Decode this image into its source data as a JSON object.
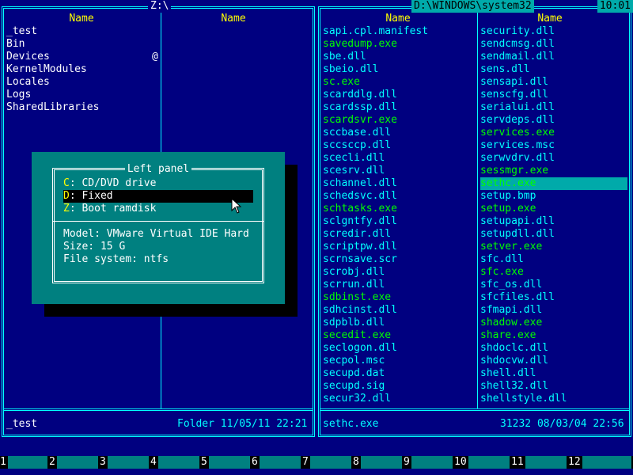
{
  "left_panel": {
    "path": "Z:\\",
    "col_headers": [
      "Name",
      "Name"
    ],
    "files": [
      "_test",
      "Bin",
      "Devices",
      "KernelModules",
      "Locales",
      "Logs",
      "SharedLibraries"
    ],
    "devices_marker": "@",
    "status_name": "_test",
    "status_info": "Folder 11/05/11 22:21"
  },
  "right_panel": {
    "path": "D:\\WINDOWS\\system32",
    "clock": "10:01",
    "col_headers": [
      "Name",
      "Name"
    ],
    "col1": [
      {
        "name": "sapi.cpl.manifest",
        "c": "c"
      },
      {
        "name": "savedump.exe",
        "c": "g"
      },
      {
        "name": "sbe.dll",
        "c": "c"
      },
      {
        "name": "sbeio.dll",
        "c": "c"
      },
      {
        "name": "sc.exe",
        "c": "g"
      },
      {
        "name": "scarddlg.dll",
        "c": "c"
      },
      {
        "name": "scardssp.dll",
        "c": "c"
      },
      {
        "name": "scardsvr.exe",
        "c": "g"
      },
      {
        "name": "sccbase.dll",
        "c": "c"
      },
      {
        "name": "sccsccp.dll",
        "c": "c"
      },
      {
        "name": "scecli.dll",
        "c": "c"
      },
      {
        "name": "scesrv.dll",
        "c": "c"
      },
      {
        "name": "schannel.dll",
        "c": "c"
      },
      {
        "name": "schedsvc.dll",
        "c": "c"
      },
      {
        "name": "schtasks.exe",
        "c": "g"
      },
      {
        "name": "sclgntfy.dll",
        "c": "c"
      },
      {
        "name": "scredir.dll",
        "c": "c"
      },
      {
        "name": "scriptpw.dll",
        "c": "c"
      },
      {
        "name": "scrnsave.scr",
        "c": "c"
      },
      {
        "name": "scrobj.dll",
        "c": "c"
      },
      {
        "name": "scrrun.dll",
        "c": "c"
      },
      {
        "name": "sdbinst.exe",
        "c": "g"
      },
      {
        "name": "sdhcinst.dll",
        "c": "c"
      },
      {
        "name": "sdpblb.dll",
        "c": "c"
      },
      {
        "name": "secedit.exe",
        "c": "g"
      },
      {
        "name": "seclogon.dll",
        "c": "c"
      },
      {
        "name": "secpol.msc",
        "c": "c"
      },
      {
        "name": "secupd.dat",
        "c": "c"
      },
      {
        "name": "secupd.sig",
        "c": "c"
      },
      {
        "name": "secur32.dll",
        "c": "c"
      }
    ],
    "col2": [
      {
        "name": "security.dll",
        "c": "c"
      },
      {
        "name": "sendcmsg.dll",
        "c": "c"
      },
      {
        "name": "sendmail.dll",
        "c": "c"
      },
      {
        "name": "sens.dll",
        "c": "c"
      },
      {
        "name": "sensapi.dll",
        "c": "c"
      },
      {
        "name": "senscfg.dll",
        "c": "c"
      },
      {
        "name": "serialui.dll",
        "c": "c"
      },
      {
        "name": "servdeps.dll",
        "c": "c"
      },
      {
        "name": "services.exe",
        "c": "g"
      },
      {
        "name": "services.msc",
        "c": "c"
      },
      {
        "name": "serwvdrv.dll",
        "c": "c"
      },
      {
        "name": "sessmgr.exe",
        "c": "g"
      },
      {
        "name": "sethc.exe",
        "c": "g",
        "sel": true
      },
      {
        "name": "setup.bmp",
        "c": "c"
      },
      {
        "name": "setup.exe",
        "c": "g"
      },
      {
        "name": "setupapi.dll",
        "c": "c"
      },
      {
        "name": "setupdll.dll",
        "c": "c"
      },
      {
        "name": "setver.exe",
        "c": "g"
      },
      {
        "name": "sfc.dll",
        "c": "c"
      },
      {
        "name": "sfc.exe",
        "c": "g"
      },
      {
        "name": "sfc_os.dll",
        "c": "c"
      },
      {
        "name": "sfcfiles.dll",
        "c": "c"
      },
      {
        "name": "sfmapi.dll",
        "c": "c"
      },
      {
        "name": "shadow.exe",
        "c": "g"
      },
      {
        "name": "share.exe",
        "c": "g"
      },
      {
        "name": "shdoclc.dll",
        "c": "c"
      },
      {
        "name": "shdocvw.dll",
        "c": "c"
      },
      {
        "name": "shell.dll",
        "c": "c"
      },
      {
        "name": "shell32.dll",
        "c": "c"
      },
      {
        "name": "shellstyle.dll",
        "c": "c"
      }
    ],
    "status_name": "sethc.exe",
    "status_info": "31232 08/03/04 22:56"
  },
  "dialog": {
    "title": "Left panel",
    "drives": [
      {
        "key": "C",
        "label": ": CD/DVD drive"
      },
      {
        "key": "D",
        "label": ": Fixed",
        "selected": true
      },
      {
        "key": "Z",
        "label": ": Boot ramdisk"
      }
    ],
    "info": [
      "Model: VMware Virtual IDE Hard",
      "Size: 15 G",
      "File system: ntfs"
    ]
  },
  "keybar": [
    "1",
    "2",
    "3",
    "4",
    "5",
    "6",
    "7",
    "8",
    "9",
    "10",
    "11",
    "12"
  ],
  "colors": {
    "background": "#000080",
    "frame": "#00FFFF",
    "executable": "#00FF00",
    "header": "#FFFF00",
    "selection": "#00AAAA",
    "dialog": "#008080"
  }
}
